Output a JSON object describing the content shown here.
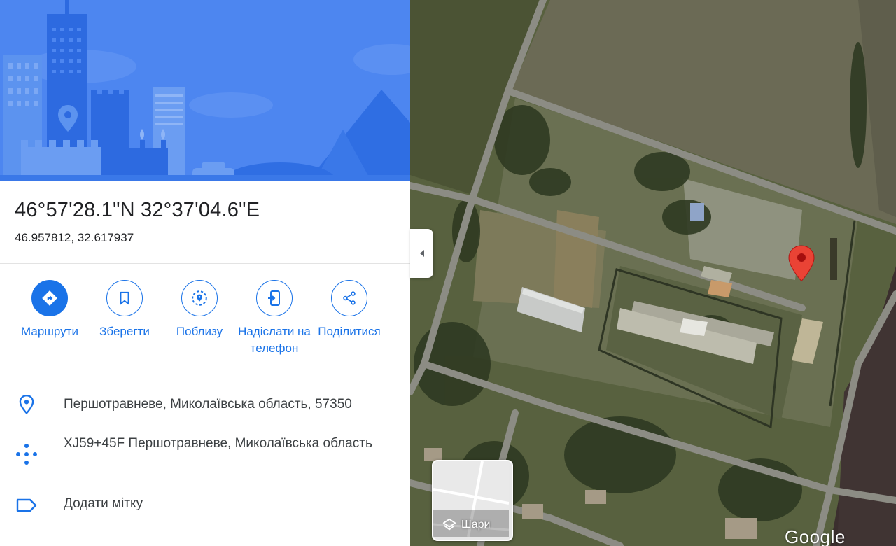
{
  "place": {
    "dms": "46°57'28.1\"N 32°37'04.6\"E",
    "decimal": "46.957812, 32.617937"
  },
  "actions": [
    {
      "label": "Маршрути",
      "icon": "directions-icon",
      "filled": true
    },
    {
      "label": "Зберегти",
      "icon": "bookmark-icon",
      "filled": false
    },
    {
      "label": "Поблизу",
      "icon": "nearby-icon",
      "filled": false
    },
    {
      "label": "Надіслати на телефон",
      "icon": "send-to-phone-icon",
      "filled": false
    },
    {
      "label": "Поділитися",
      "icon": "share-icon",
      "filled": false
    }
  ],
  "info": {
    "address": "Першотравневе, Миколаївська область, 57350",
    "plus_code": "XJ59+45F Першотравневе, Миколаївська область",
    "add_label": "Додати мітку"
  },
  "map": {
    "layers_label": "Шари",
    "logo": "Google"
  },
  "colors": {
    "accent": "#1a73e8",
    "pin": "#ea4335"
  }
}
